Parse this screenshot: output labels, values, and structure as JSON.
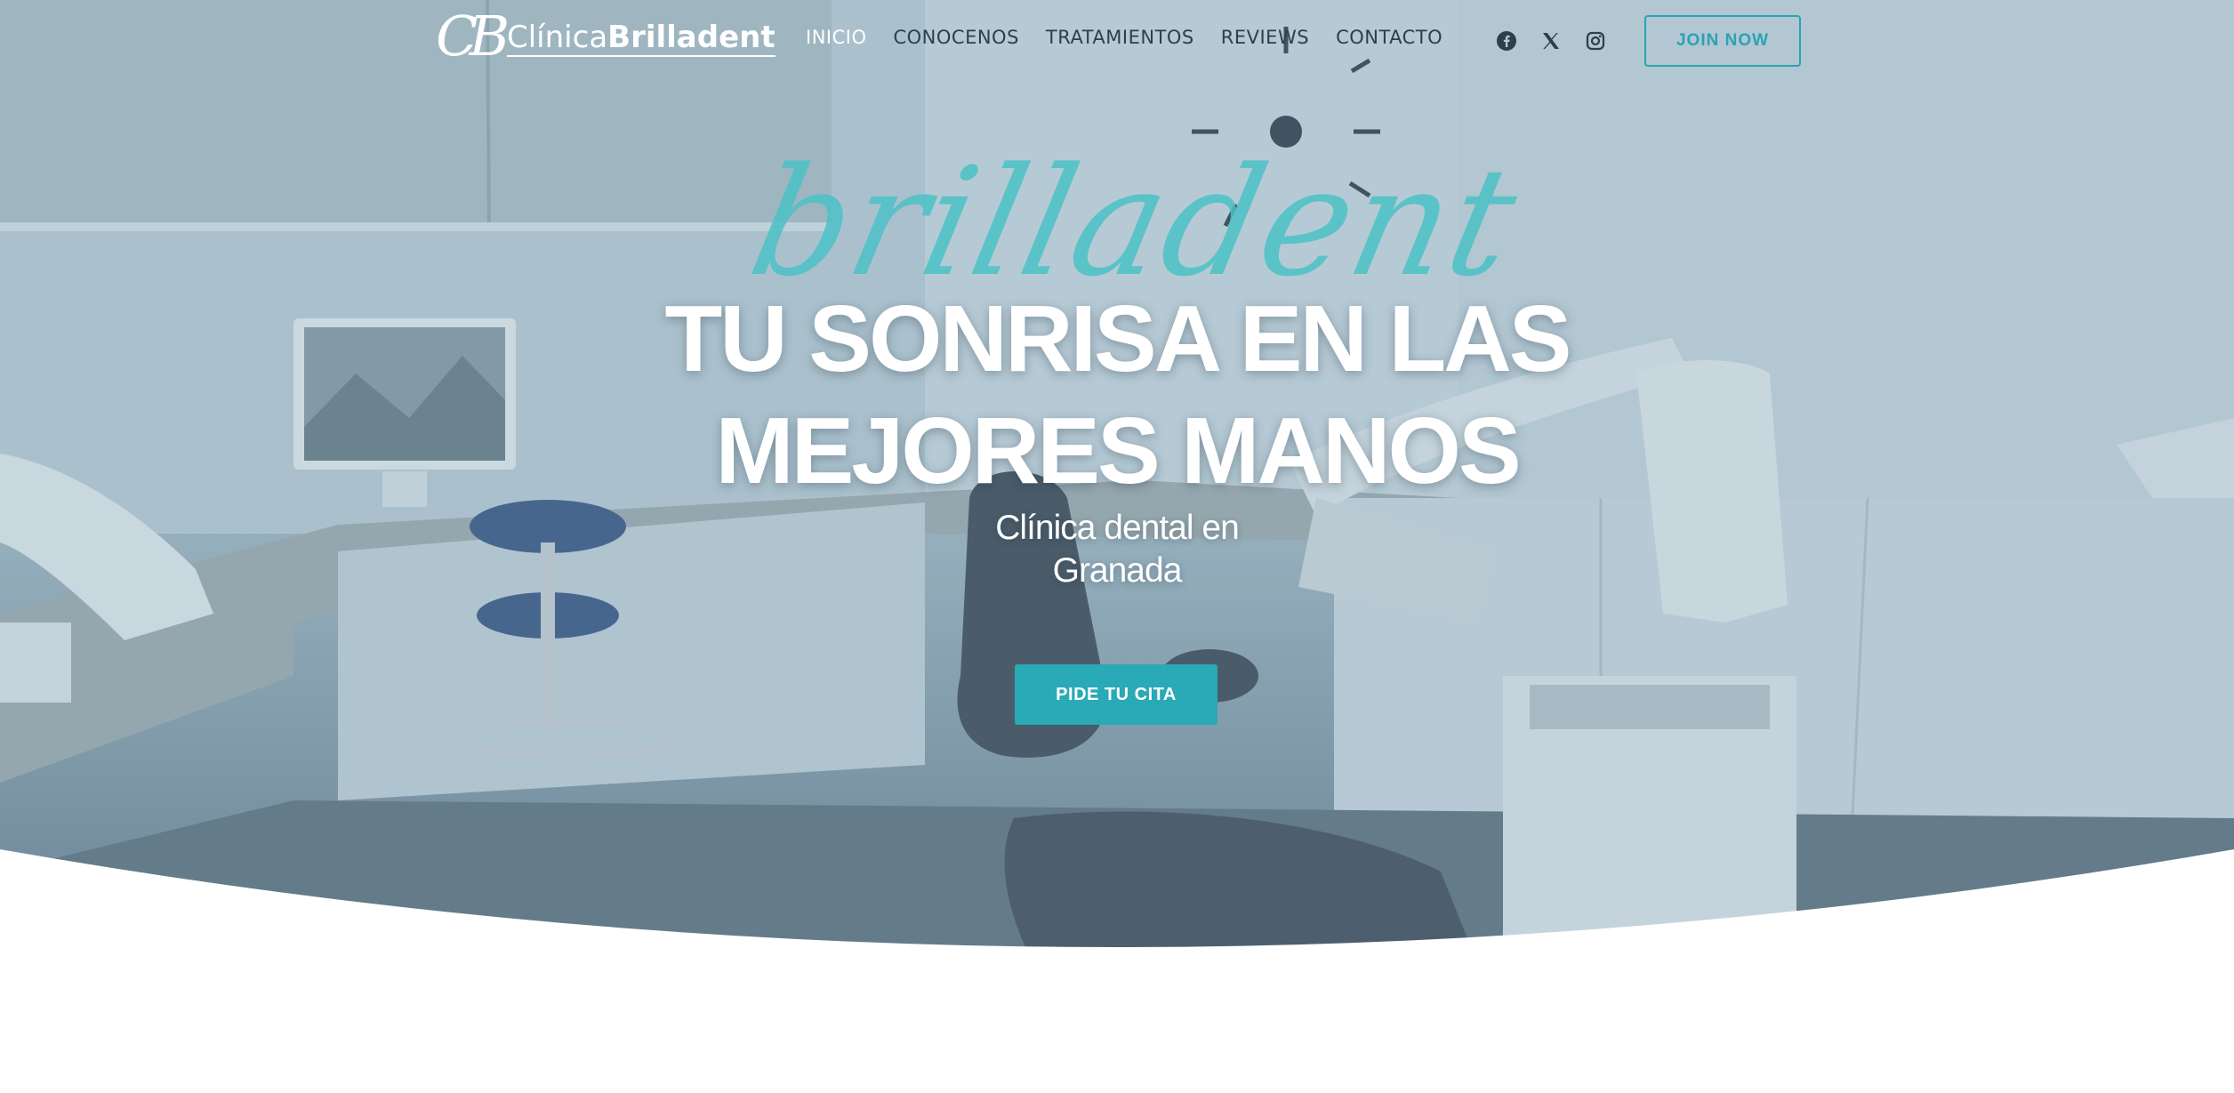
{
  "header": {
    "logo_mark": "CB",
    "logo_text_light": "Clínica",
    "logo_text_bold": "Brilladent",
    "nav": [
      {
        "label": "INICIO"
      },
      {
        "label": "CONOCENOS"
      },
      {
        "label": "TRATAMIENTOS"
      },
      {
        "label": "REVIEWS"
      },
      {
        "label": "CONTACTO"
      }
    ],
    "social": [
      "facebook-icon",
      "x-twitter-icon",
      "instagram-icon"
    ],
    "join_label": "JOIN NOW"
  },
  "hero": {
    "script_text": "brilladent",
    "headline_line1": "TU SONRISA EN LAS",
    "headline_line2": "MEJORES MANOS",
    "subhead_line1": "Clínica dental en",
    "subhead_line2": "Granada",
    "cta_label": "PIDE TU CITA"
  },
  "colors": {
    "accent": "#2aa9b6",
    "script": "#4bc2c6",
    "nav_text": "#2b3f4c",
    "white": "#ffffff"
  }
}
